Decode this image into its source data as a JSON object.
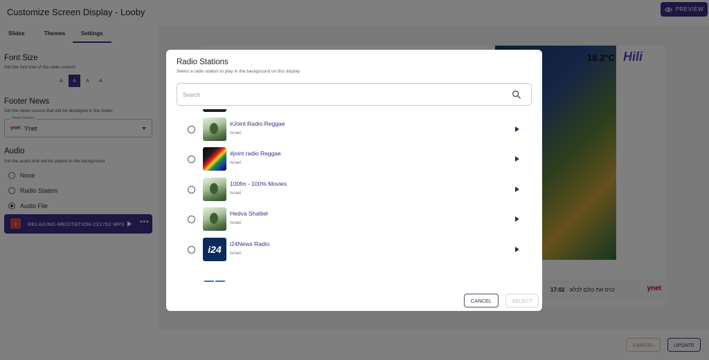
{
  "header": {
    "title": "Customize Screen Display - Looby",
    "preview_label": "PREVIEW"
  },
  "sidebar": {
    "tabs": [
      {
        "label": "Slides",
        "active": false
      },
      {
        "label": "Themes",
        "active": false
      },
      {
        "label": "Settings",
        "active": true
      }
    ],
    "font_size": {
      "title": "Font Size",
      "subtitle": "Set the font size of the slide content",
      "options": [
        "A",
        "A",
        "A",
        "A"
      ],
      "selected_index": 1
    },
    "footer_news": {
      "title": "Footer News",
      "subtitle": "Set the news source that will be displayed in the footer",
      "field_label": "News Source",
      "logo_text": "ynet",
      "value": "Ynet"
    },
    "audio": {
      "title": "Audio",
      "subtitle": "Set the audio that will be played in the background",
      "options": [
        "None",
        "Radio Station",
        "Audio File"
      ],
      "selected": "Audio File",
      "file": {
        "icon": "music-note-icon",
        "name": "RELAXING-MEDITATION-231762.MP3",
        "more": "•••"
      }
    }
  },
  "preview": {
    "weather": "18.2°C",
    "brand": "Hili",
    "ticker_time": "17:02",
    "ticker_text": "כניס את כולם לכלא",
    "ticker_logo": "ynet"
  },
  "footer": {
    "cancel_label": "CANCEL",
    "update_label": "UPDATE"
  },
  "dialog": {
    "title": "Radio Stations",
    "subtitle": "Select a radio station to play in the background on this display",
    "search_placeholder": "Search",
    "stations": [
      {
        "name": "#Joint Radio Reggae",
        "country": "Israel",
        "thumb": "nature"
      },
      {
        "name": "#joint radio Reggae",
        "country": "Israel",
        "thumb": "reggae"
      },
      {
        "name": "100fm - 100% Movies",
        "country": "Israel",
        "thumb": "nature"
      },
      {
        "name": "Hedva Shaltiel",
        "country": "Israel",
        "thumb": "nature"
      },
      {
        "name": "i24News Radio",
        "country": "Israel",
        "thumb": "i24",
        "thumb_text": "i24"
      }
    ],
    "cancel_label": "CANCEL",
    "select_label": "SELECT"
  },
  "colors": {
    "accent": "#3d2d86",
    "overlay": "rgba(0,0,0,0.5)",
    "cancel_outline": "#e07a5f"
  }
}
